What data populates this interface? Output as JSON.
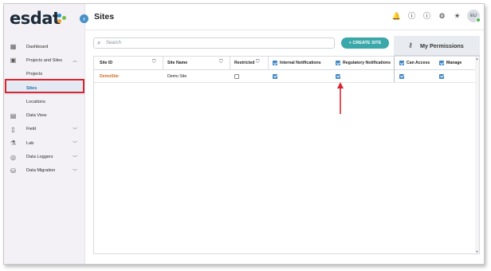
{
  "app": {
    "logo_text": "esdat",
    "logo_dot_colors": [
      "#2b8fd0",
      "#6fbf45",
      "#f0a030"
    ]
  },
  "sidebar": {
    "items": [
      {
        "label": "Dashboard",
        "icon": "dashboard-icon",
        "chevron": ""
      },
      {
        "label": "Projects and Sites",
        "icon": "projects-icon",
        "chevron": "chevron-up"
      },
      {
        "label": "Projects",
        "icon": "",
        "chevron": ""
      },
      {
        "label": "Sites",
        "icon": "",
        "chevron": "",
        "active": true
      },
      {
        "label": "Locations",
        "icon": "",
        "chevron": ""
      },
      {
        "label": "Data View",
        "icon": "table-icon",
        "chevron": ""
      },
      {
        "label": "Field",
        "icon": "phone-icon",
        "chevron": "chevron-down"
      },
      {
        "label": "Lab",
        "icon": "flask-icon",
        "chevron": "chevron-down"
      },
      {
        "label": "Data Loggers",
        "icon": "logger-icon",
        "chevron": "chevron-down"
      },
      {
        "label": "Data Migration",
        "icon": "database-icon",
        "chevron": "chevron-down"
      }
    ]
  },
  "header": {
    "title": "Sites",
    "avatar_initials": "EU",
    "icons": [
      "bell-icon",
      "help-icon",
      "info-icon",
      "settings-icon",
      "theme-toggle-icon"
    ]
  },
  "toolbar": {
    "search_placeholder": "Search",
    "create_label": "+ CREATE SITE"
  },
  "permissions": {
    "title": "My Permissions"
  },
  "table": {
    "columns": [
      "Site ID",
      "Site Name",
      "Restricted",
      "Internal Notifications",
      "Regulatory Notifications",
      "Can Access",
      "Manage"
    ],
    "rows": [
      {
        "site_id": "DemoSite",
        "site_name": "Demo Site",
        "restricted": false,
        "internal_notifications": true,
        "regulatory_notifications": true,
        "can_access": true,
        "manage": true
      }
    ]
  },
  "colors": {
    "accent": "#3aa8a9",
    "checkbox": "#3f86c6",
    "link": "#d2691e",
    "highlight": "#d7262f"
  }
}
